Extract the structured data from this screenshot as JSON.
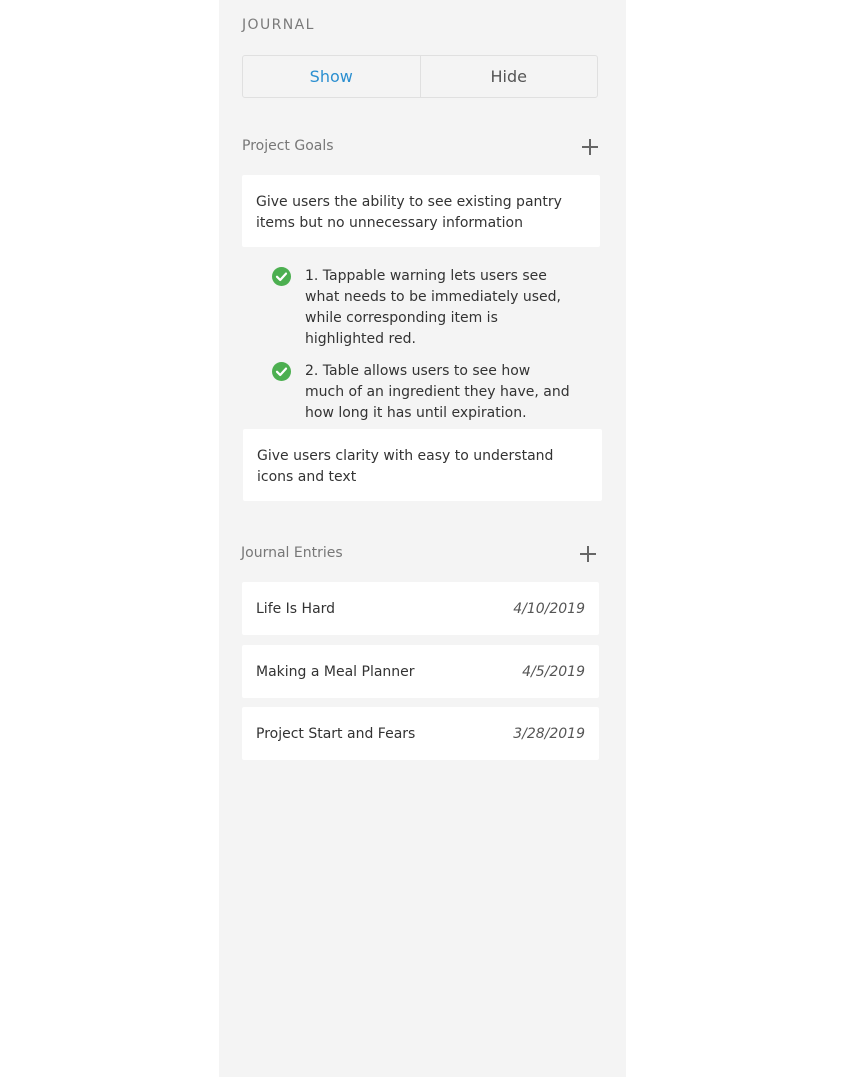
{
  "journal": {
    "title": "JOURNAL",
    "toggle": {
      "show_label": "Show",
      "hide_label": "Hide",
      "selected": "Show"
    }
  },
  "goals": {
    "header": "Project Goals",
    "add_icon": "plus-icon",
    "items": [
      {
        "text": "Give users the ability to see existing pantry items but no unnecessary information"
      },
      {
        "text": "Give users clarity with easy to understand icons and text"
      }
    ],
    "criteria": [
      {
        "text": "1. Tappable warning lets users see what needs to be immediately used, while corresponding item is highlighted red.",
        "icon": "check-circle-icon"
      },
      {
        "text": "2. Table allows users to see how much of an ingredient they have, and how long it has until expiration.",
        "icon": "check-circle-icon"
      }
    ],
    "check_color": "#4caf50"
  },
  "entries": {
    "header": "Journal Entries",
    "add_icon": "plus-icon",
    "items": [
      {
        "title": "Life Is Hard",
        "date": "4/10/2019"
      },
      {
        "title": "Making a Meal Planner",
        "date": "4/5/2019"
      },
      {
        "title": "Project Start and Fears",
        "date": "3/28/2019"
      }
    ]
  },
  "colors": {
    "accent": "#2b8fd0",
    "panel_bg": "#f4f4f4"
  }
}
